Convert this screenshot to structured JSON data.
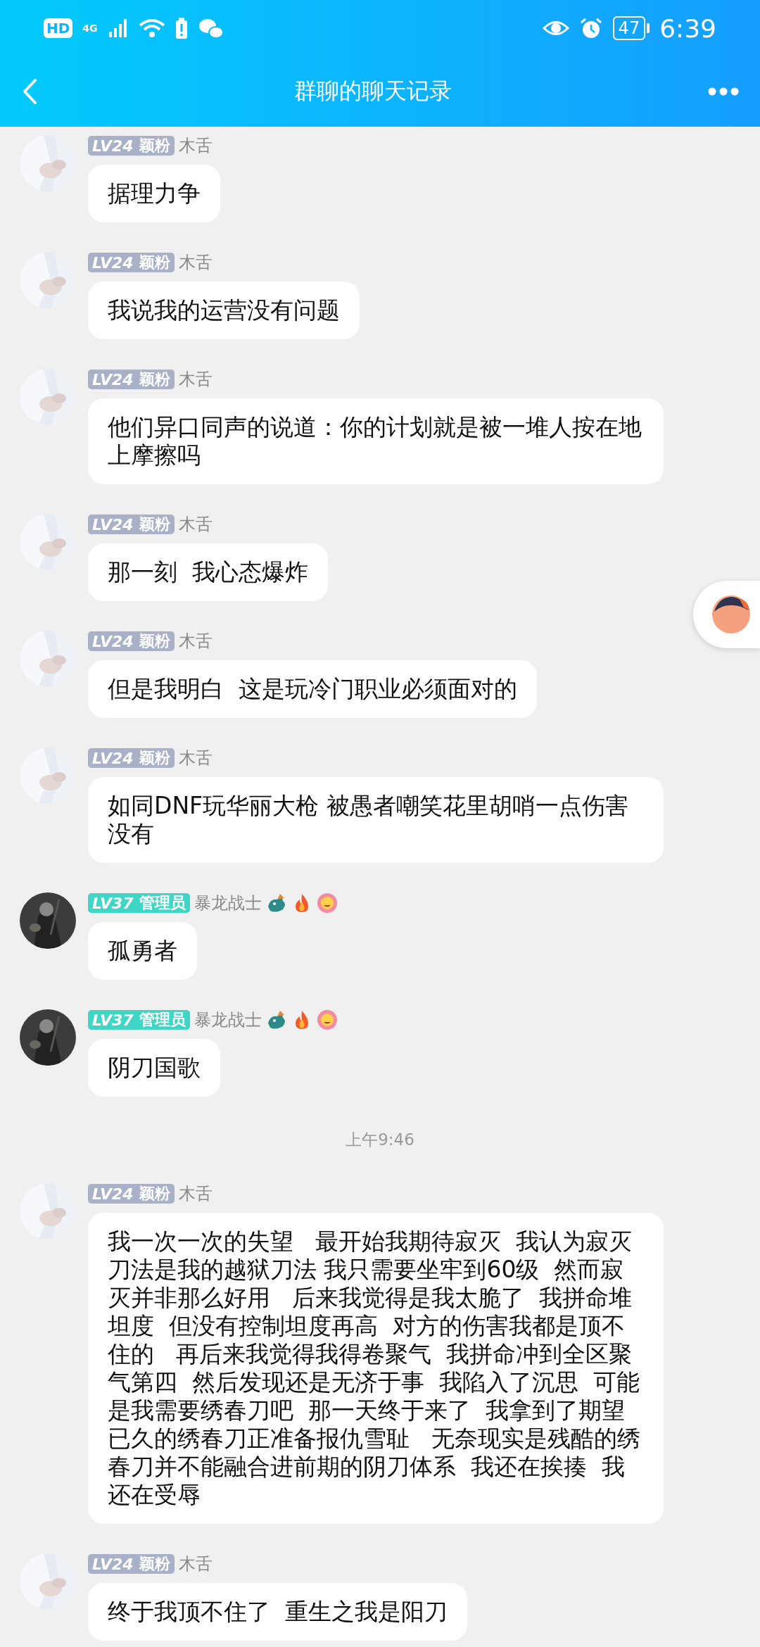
{
  "status_bar": {
    "hd": "HD",
    "network": "4G",
    "battery": "47",
    "time": "6:39"
  },
  "header": {
    "title": "群聊的聊天记录"
  },
  "messages": [
    {
      "kind": "message",
      "badge": {
        "level": "LV24",
        "rank": "颖粉",
        "color": "#a9b1c9"
      },
      "name": "木舌",
      "decorated": false,
      "text": "据理力争"
    },
    {
      "kind": "message",
      "badge": {
        "level": "LV24",
        "rank": "颖粉",
        "color": "#a9b1c9"
      },
      "name": "木舌",
      "decorated": false,
      "text": "我说我的运营没有问题"
    },
    {
      "kind": "message",
      "badge": {
        "level": "LV24",
        "rank": "颖粉",
        "color": "#a9b1c9"
      },
      "name": "木舌",
      "decorated": false,
      "text": "他们异口同声的说道：你的计划就是被一堆人按在地上摩擦吗"
    },
    {
      "kind": "message",
      "badge": {
        "level": "LV24",
        "rank": "颖粉",
        "color": "#a9b1c9"
      },
      "name": "木舌",
      "decorated": false,
      "text": "那一刻  我心态爆炸"
    },
    {
      "kind": "message",
      "badge": {
        "level": "LV24",
        "rank": "颖粉",
        "color": "#a9b1c9"
      },
      "name": "木舌",
      "decorated": false,
      "text": "但是我明白  这是玩冷门职业必须面对的"
    },
    {
      "kind": "message",
      "badge": {
        "level": "LV24",
        "rank": "颖粉",
        "color": "#a9b1c9"
      },
      "name": "木舌",
      "decorated": false,
      "text": "如同DNF玩华丽大枪 被愚者嘲笑花里胡哨一点伤害没有"
    },
    {
      "kind": "message",
      "badge": {
        "level": "LV37",
        "rank": "管理员",
        "color": "#3fd6c6"
      },
      "name": "暴龙战士",
      "decorated": true,
      "text": "孤勇者"
    },
    {
      "kind": "message",
      "badge": {
        "level": "LV37",
        "rank": "管理员",
        "color": "#3fd6c6"
      },
      "name": "暴龙战士",
      "decorated": true,
      "text": "阴刀国歌"
    },
    {
      "kind": "time",
      "text": "上午9:46"
    },
    {
      "kind": "message",
      "badge": {
        "level": "LV24",
        "rank": "颖粉",
        "color": "#a9b1c9"
      },
      "name": "木舌",
      "decorated": false,
      "text": "我一次一次的失望   最开始我期待寂灭  我认为寂灭刀法是我的越狱刀法 我只需要坐牢到60级  然而寂灭并非那么好用   后来我觉得是我太脆了  我拼命堆坦度  但没有控制坦度再高  对方的伤害我都是顶不住的   再后来我觉得我得卷聚气  我拼命冲到全区聚气第四  然后发现还是无济于事  我陷入了沉思  可能是我需要绣春刀吧  那一天终于来了  我拿到了期望已久的绣春刀正准备报仇雪耻   无奈现实是残酷的绣春刀并不能融合进前期的阴刀体系  我还在挨揍  我还在受辱"
    },
    {
      "kind": "message",
      "badge": {
        "level": "LV24",
        "rank": "颖粉",
        "color": "#a9b1c9"
      },
      "name": "木舌",
      "decorated": false,
      "text": "终于我顶不住了  重生之我是阳刀"
    }
  ]
}
